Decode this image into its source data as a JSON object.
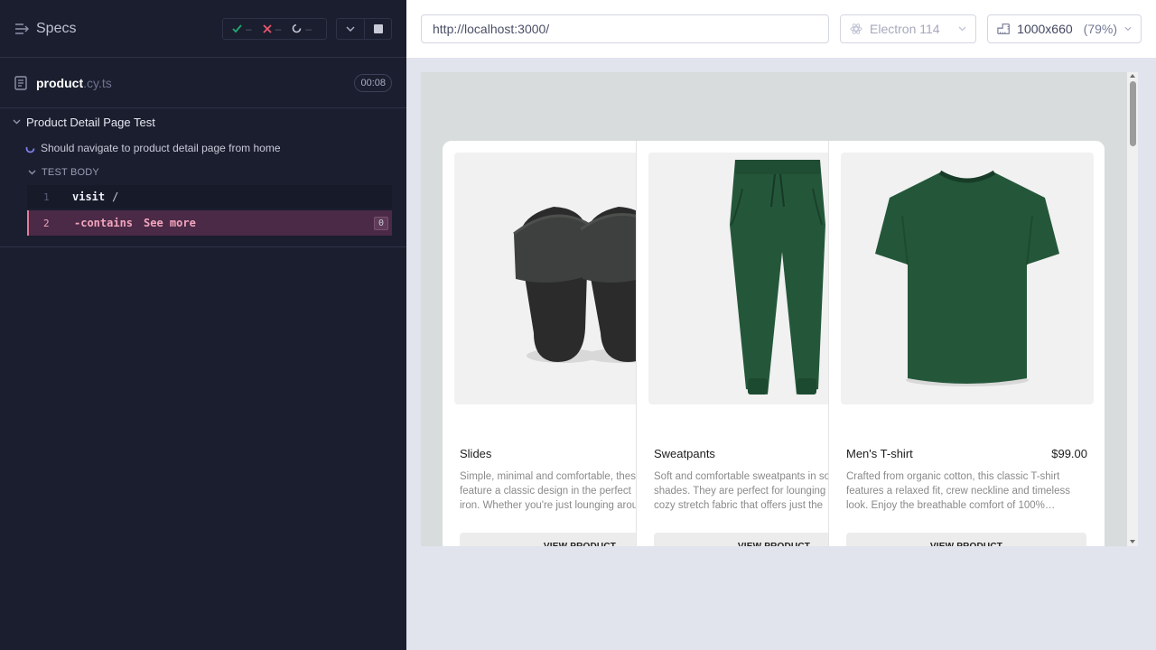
{
  "sidebar": {
    "header": {
      "title": "Specs",
      "passed_count": "–",
      "failed_count": "–",
      "pending_count": "–"
    },
    "spec": {
      "name": "product",
      "ext": ".cy.ts",
      "duration": "00:08"
    },
    "suite": {
      "title": "Product Detail Page Test"
    },
    "test": {
      "title": "Should navigate to product detail page from home"
    },
    "test_body": {
      "label": "TEST BODY"
    },
    "commands": [
      {
        "num": "1",
        "name": "visit",
        "arg": "/"
      },
      {
        "num": "2",
        "name": "-contains",
        "arg": "See more",
        "badge": "0"
      }
    ]
  },
  "topbar": {
    "url": "http://localhost:3000/",
    "browser": "Electron 114",
    "viewport": "1000x660",
    "zoom": "(79%)"
  },
  "products": [
    {
      "name": "Slides",
      "price": "",
      "desc_lines": [
        "Simple, minimal and comfortable, these",
        "feature a classic design in the perfect",
        "iron. Whether you're just lounging around"
      ],
      "button": "VIEW PRODUCT"
    },
    {
      "name": "Sweatpants",
      "price": "",
      "desc_lines": [
        "Soft and comfortable sweatpants in soft",
        "shades. They are perfect for lounging",
        "cozy stretch fabric that offers just the"
      ],
      "button": "VIEW PRODUCT"
    },
    {
      "name": "Men's T-shirt",
      "price": "$99.00",
      "desc": "Crafted from organic cotton, this classic T-shirt features a relaxed fit, crew neckline and timeless look. Enjoy the breathable comfort of 100%…",
      "button": "VIEW PRODUCT"
    }
  ],
  "colors": {
    "sidebar_bg": "#1b1e2e",
    "accent_pass": "#1fa971",
    "accent_fail": "#e45770",
    "command_failed_bg": "#4a2a46",
    "product_green": "#24573a"
  }
}
